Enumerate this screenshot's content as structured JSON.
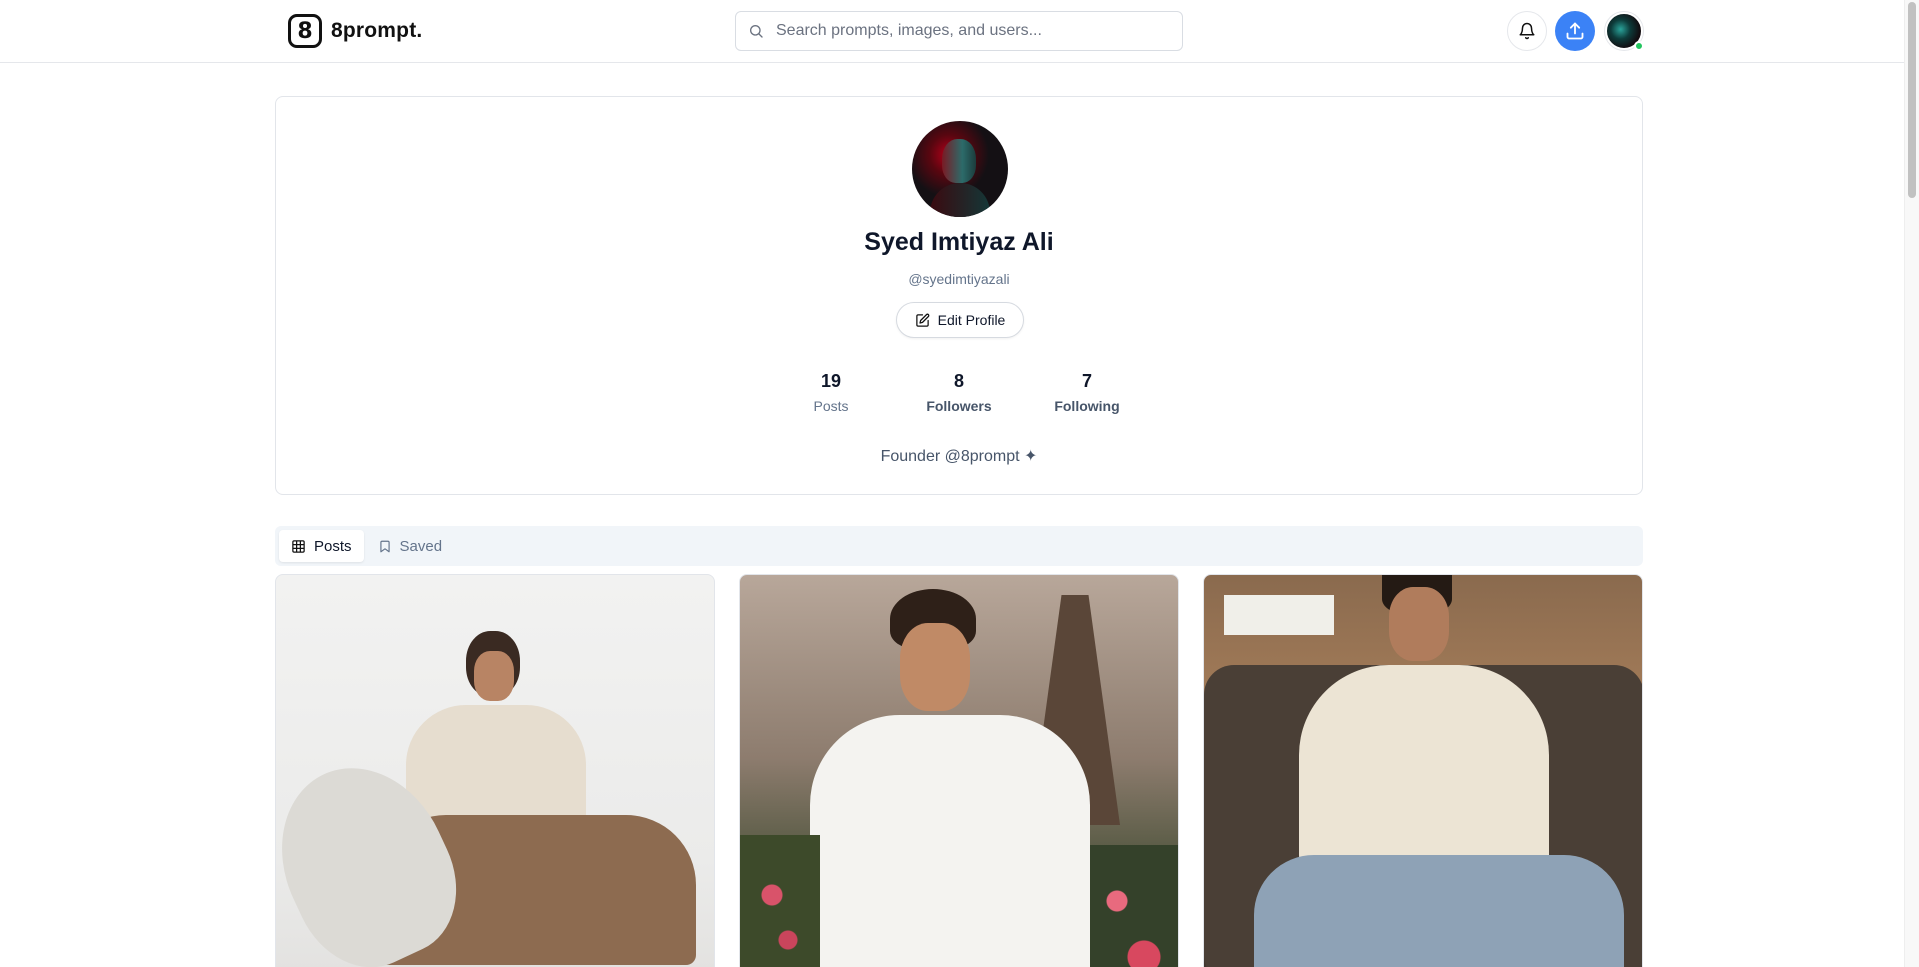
{
  "app": {
    "logo_glyph": "8",
    "name": "8prompt."
  },
  "search": {
    "placeholder": "Search prompts, images, and users..."
  },
  "header_icons": [
    "bell-icon",
    "upload-icon",
    "user-avatar"
  ],
  "profile": {
    "name": "Syed Imtiyaz Ali",
    "handle": "@syedimtiyazali",
    "edit_label": "Edit Profile",
    "stats": [
      {
        "value": "19",
        "label": "Posts"
      },
      {
        "value": "8",
        "label": "Followers"
      },
      {
        "value": "7",
        "label": "Following"
      }
    ],
    "bio": "Founder @8prompt ✦"
  },
  "tabs": [
    {
      "label": "Posts",
      "icon": "grid-icon",
      "active": true
    },
    {
      "label": "Saved",
      "icon": "bookmark-icon",
      "active": false
    }
  ],
  "posts": [
    {
      "name": "man seated on white studio floor in beige outfit"
    },
    {
      "name": "man in white shirt before windmill and roses"
    },
    {
      "name": "man in cream sweater on brown sofa"
    }
  ],
  "colors": {
    "accent": "#3b82f6",
    "online": "#22c55e",
    "muted_text": "#64748b",
    "tab_bg": "#f1f5f9"
  }
}
